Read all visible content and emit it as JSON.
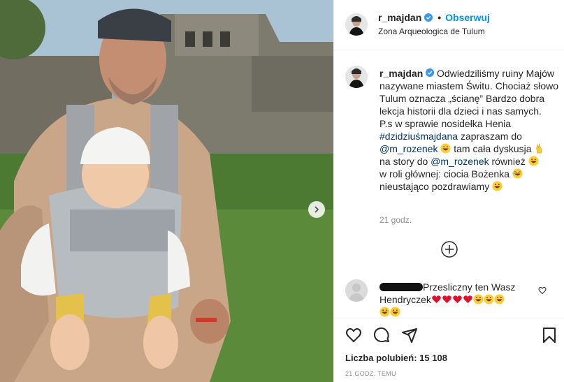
{
  "post": {
    "slide_next_label": "next-slide"
  },
  "header": {
    "username": "r_majdan",
    "dot": "•",
    "follow_label": "Obserwuj",
    "location": "Zona Arqueologica de Tulum"
  },
  "caption": {
    "username": "r_majdan",
    "line1": "Odwiedziliśmy ruiny Majów nazywane miastem Świtu.",
    "line2": "Chociaż słowo Tulum oznacza „ścianę” Bardzo dobra lekcja historii dla dzieci i nas samych.",
    "line3": "P.s w sprawie nosidełka Henia",
    "hashtag": "#dzidziuśmajdana",
    "line4a": " zapraszam do",
    "mention1": "@m_rozenek",
    "line4b": " tam cała dyskusja",
    "line5a": "na story do ",
    "mention2": "@m_rozenek",
    "line5b": " również",
    "line6": "w roli głównej: ciocia Bożenka",
    "line7": "nieustająco pozdrawiamy",
    "time": "21 godz."
  },
  "comment": {
    "text1": "Przesliczny ten Wasz",
    "text2": "Hendryczek"
  },
  "footer": {
    "likes": "Liczba polubień: 15 108",
    "ago": "21 GODZ. TEMU"
  },
  "colors": {
    "link": "#0095f6",
    "tag": "#00376b",
    "heart_red": "#ed4956",
    "muted": "#8e8e8e"
  },
  "icons": [
    "verified-icon",
    "next-arrow-icon",
    "add-comment-icon",
    "like-icon",
    "comment-icon",
    "share-icon",
    "save-icon"
  ]
}
